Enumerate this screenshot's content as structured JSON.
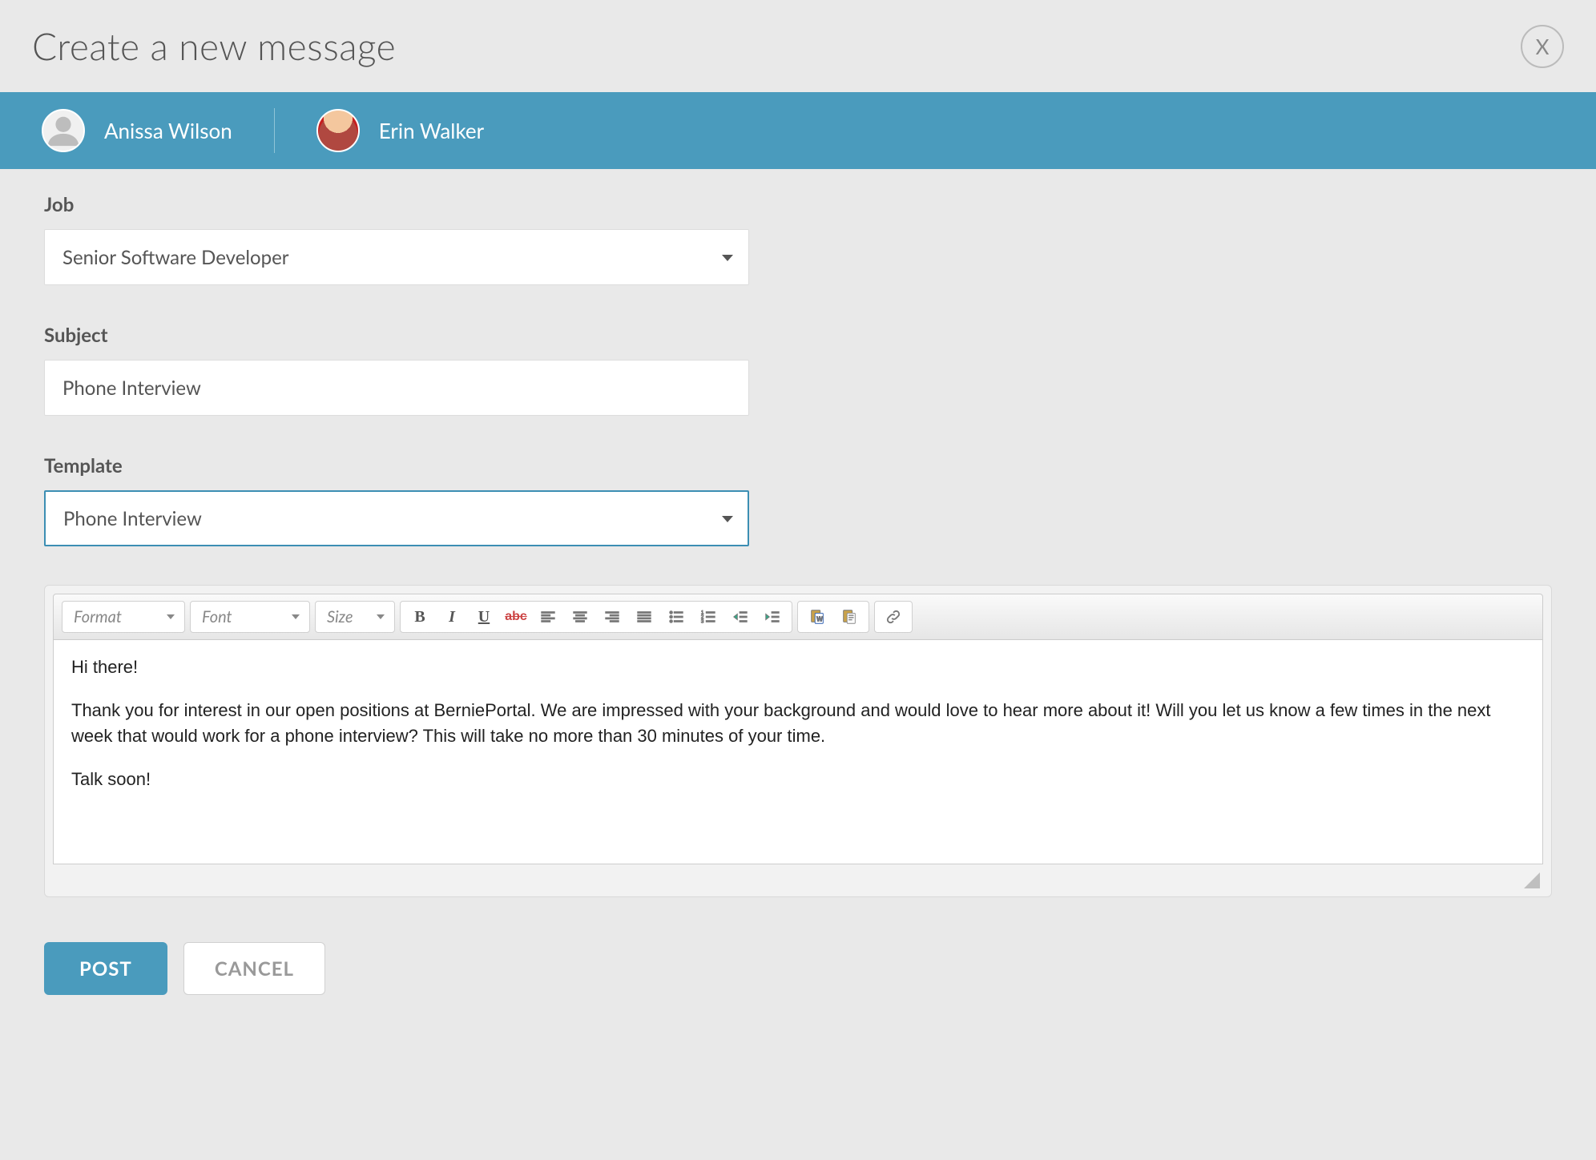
{
  "header": {
    "title": "Create a new message",
    "close_label": "X"
  },
  "recipients": [
    {
      "name": "Anissa Wilson",
      "avatar_type": "placeholder"
    },
    {
      "name": "Erin Walker",
      "avatar_type": "photo"
    }
  ],
  "fields": {
    "job": {
      "label": "Job",
      "value": "Senior Software Developer"
    },
    "subject": {
      "label": "Subject",
      "value": "Phone Interview"
    },
    "template": {
      "label": "Template",
      "value": "Phone Interview"
    }
  },
  "editor": {
    "toolbar": {
      "format": "Format",
      "font": "Font",
      "size": "Size",
      "strike_text": "abc"
    },
    "body": {
      "p1": "Hi there!",
      "p2": "Thank you for interest in our open positions at BerniePortal. We are impressed with your background and would love to hear more about it! Will you let us know a few times in the next week that would work for a phone interview? This will take no more than 30 minutes of your time.",
      "p3": "Talk soon!"
    }
  },
  "actions": {
    "post": "POST",
    "cancel": "CANCEL"
  }
}
